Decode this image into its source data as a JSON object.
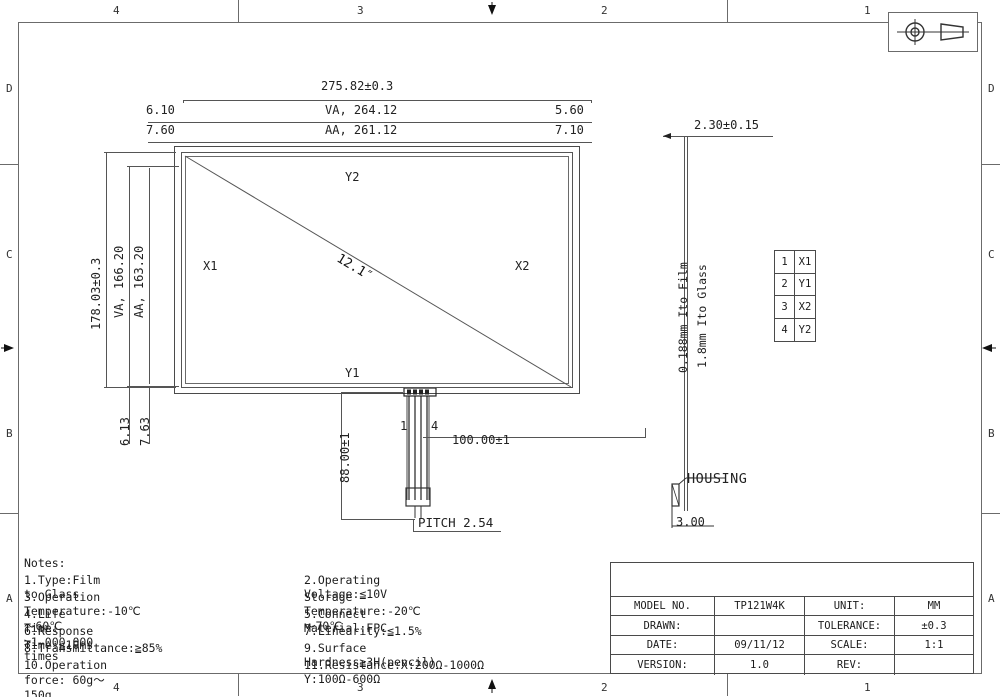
{
  "drawing": {
    "title_symbol": "first-angle-projection",
    "zones": {
      "top": [
        "4",
        "3",
        "2",
        "1"
      ],
      "bottom": [
        "4",
        "3",
        "2",
        "1"
      ],
      "left": [
        "D",
        "C",
        "B",
        "A"
      ],
      "right": [
        "D",
        "C",
        "B",
        "A"
      ]
    }
  },
  "front_view": {
    "overall_width": "275.82±0.3",
    "va_width": "VA, 264.12",
    "aa_width": "AA, 261.12",
    "overall_height": "178.03±0.3",
    "va_height": "VA, 166.20",
    "aa_height": "AA, 163.20",
    "left_margin_1": "6.10",
    "left_margin_2": "7.60",
    "right_margin_1": "5.60",
    "right_margin_2": "7.10",
    "bottom_margin_1": "6.13",
    "bottom_margin_2": "7.63",
    "diagonal_size": "12.1″",
    "electrodes": {
      "top": "Y2",
      "bottom": "Y1",
      "left": "X1",
      "right": "X2"
    }
  },
  "tail": {
    "pin_first": "1",
    "pin_last": "4",
    "length": "88.00±1",
    "offset": "100.00±1",
    "pitch": "PITCH 2.54"
  },
  "section_view": {
    "total_thickness": "2.30±0.15",
    "glass_layer": "1.8mm Ito Glass",
    "film_layer": "0.188mm Ito Film",
    "housing_label": "HOUSING",
    "housing_dim": "3.00"
  },
  "pin_table": {
    "rows": [
      {
        "no": "1",
        "signal": "X1"
      },
      {
        "no": "2",
        "signal": "Y1"
      },
      {
        "no": "3",
        "signal": "X2"
      },
      {
        "no": "4",
        "signal": "Y2"
      }
    ]
  },
  "notes": {
    "heading": "Notes:",
    "lines": [
      {
        "left": "1.Type:Film to Glass",
        "right": "2.Operating Voltage:≦10V"
      },
      {
        "left": "3.Operation Temperature:-10℃～60℃",
        "right": "Storage Temperature:-20℃～70℃"
      },
      {
        "left": "4.Life Time: >1,000,000 times",
        "right": "5.Connect Material:FPC"
      },
      {
        "left": "6.Response Time:≦10ms",
        "right": "7.Linearity:≦1.5%"
      },
      {
        "left": "8.Transmittance:≧85%",
        "right": "9.Surface Hardness≧3H(pencil)"
      },
      {
        "left": "10.Operation force: 60g～150g",
        "right": "11.Resistance:X:200Ω-1000Ω Y:100Ω-600Ω"
      }
    ]
  },
  "title_block": {
    "rows": [
      {
        "label": "MODEL NO.",
        "value": "TP121W4K",
        "label2": "UNIT:",
        "value2": "MM"
      },
      {
        "label": "DRAWN:",
        "value": "",
        "label2": "TOLERANCE:",
        "value2": "±0.3"
      },
      {
        "label": "DATE:",
        "value": "09/11/12",
        "label2": "SCALE:",
        "value2": "1:1"
      },
      {
        "label": "VERSION:",
        "value": "1.0",
        "label2": "REV:",
        "value2": ""
      }
    ]
  }
}
